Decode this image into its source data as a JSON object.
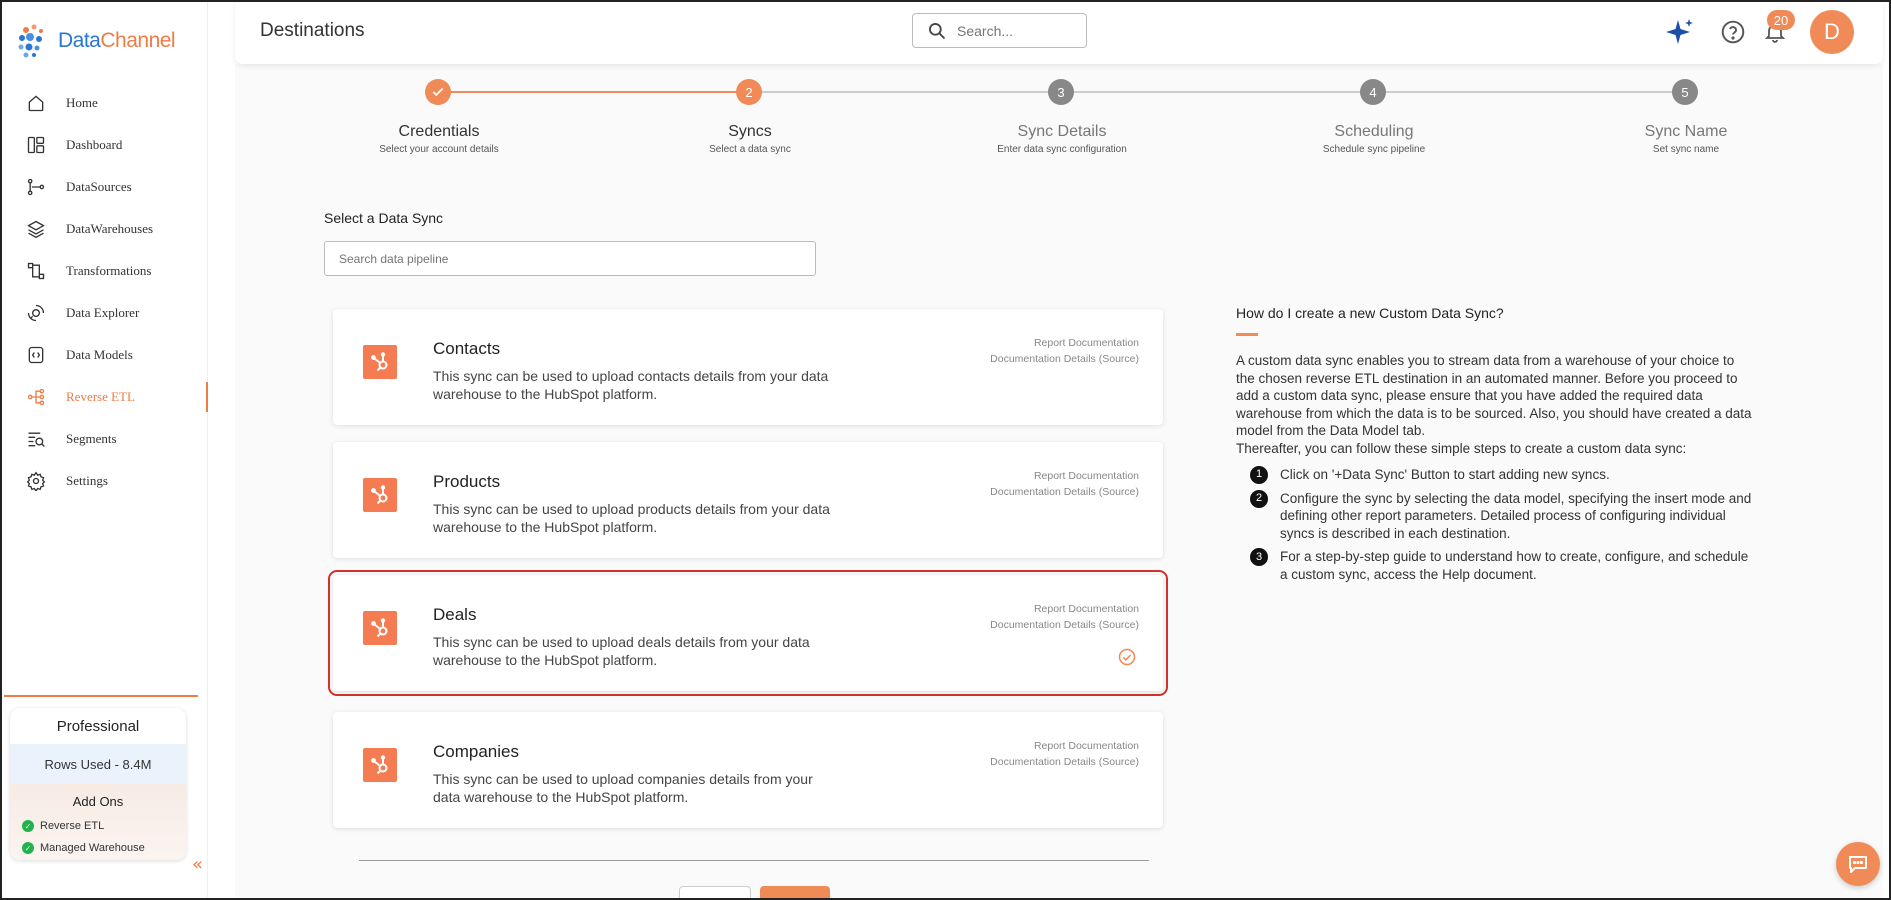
{
  "app": {
    "brand_part1": "Data",
    "brand_part2": "Channel"
  },
  "sidebar": {
    "items": [
      {
        "label": "Home",
        "icon": "home-icon"
      },
      {
        "label": "Dashboard",
        "icon": "dashboard-icon"
      },
      {
        "label": "DataSources",
        "icon": "datasources-icon"
      },
      {
        "label": "DataWarehouses",
        "icon": "layers-icon"
      },
      {
        "label": "Transformations",
        "icon": "transform-icon"
      },
      {
        "label": "Data Explorer",
        "icon": "explorer-icon"
      },
      {
        "label": "Data Models",
        "icon": "models-icon"
      },
      {
        "label": "Reverse ETL",
        "icon": "reverse-etl-icon",
        "active": true
      },
      {
        "label": "Segments",
        "icon": "segments-icon"
      },
      {
        "label": "Settings",
        "icon": "gear-icon"
      }
    ],
    "plan": {
      "title": "Professional",
      "rows_used": "Rows Used - 8.4M",
      "addons_title": "Add Ons",
      "addons": [
        "Reverse ETL",
        "Managed Warehouse"
      ]
    },
    "collapse_glyph": "«"
  },
  "header": {
    "title": "Destinations",
    "search_placeholder": "Search...",
    "notification_count": "20",
    "avatar_initial": "D"
  },
  "stepper": {
    "steps": [
      {
        "number": "1",
        "title": "Credentials",
        "subtitle": "Select your account details",
        "state": "done"
      },
      {
        "number": "2",
        "title": "Syncs",
        "subtitle": "Select a data sync",
        "state": "active"
      },
      {
        "number": "3",
        "title": "Sync Details",
        "subtitle": "Enter data sync configuration",
        "state": "pending"
      },
      {
        "number": "4",
        "title": "Scheduling",
        "subtitle": "Schedule sync pipeline",
        "state": "pending"
      },
      {
        "number": "5",
        "title": "Sync Name",
        "subtitle": "Set sync name",
        "state": "pending"
      }
    ]
  },
  "sync_select": {
    "title": "Select a Data Sync",
    "search_placeholder": "Search data pipeline",
    "cards": [
      {
        "name": "Contacts",
        "description": "This sync can be used to upload contacts details from your data warehouse to the HubSpot platform.",
        "link1": "Report Documentation",
        "link2": "Documentation Details (Source)",
        "selected": false
      },
      {
        "name": "Products",
        "description": "This sync can be used to upload products details from your data warehouse to the HubSpot platform.",
        "link1": "Report Documentation",
        "link2": "Documentation Details (Source)",
        "selected": false
      },
      {
        "name": "Deals",
        "description": "This sync can be used to upload deals details from your data warehouse to the HubSpot platform.",
        "link1": "Report Documentation",
        "link2": "Documentation Details (Source)",
        "selected": true
      },
      {
        "name": "Companies",
        "description": "This sync can be used to upload companies details from your data warehouse to the HubSpot platform.",
        "link1": "Report Documentation",
        "link2": "Documentation Details (Source)",
        "selected": false
      }
    ]
  },
  "help": {
    "title": "How do I create a new Custom Data Sync?",
    "paragraph": "A custom data sync enables you to stream data from a warehouse of your choice to the chosen reverse ETL destination in an automated manner. Before you proceed to add a custom data sync, please ensure that you have added the required data warehouse from which the data is to be sourced. Also, you should have created a data model from the Data Model tab.",
    "paragraph2": "Thereafter, you can follow these simple steps to create a custom data sync:",
    "steps": [
      {
        "num": "1",
        "text": "Click on '+Data Sync' Button to start adding new syncs."
      },
      {
        "num": "2",
        "text": "Configure the sync by selecting the data model, specifying the insert mode and defining other report parameters. Detailed process of configuring individual syncs is described in each destination."
      },
      {
        "num": "3",
        "text": "For a step-by-step guide to understand how to create, configure, and schedule a custom sync, access the Help document."
      }
    ]
  },
  "colors": {
    "accent": "#f08a57",
    "hubspot": "#f47b52",
    "selected_outline": "#d0312d",
    "brand_blue": "#2a76d2"
  }
}
